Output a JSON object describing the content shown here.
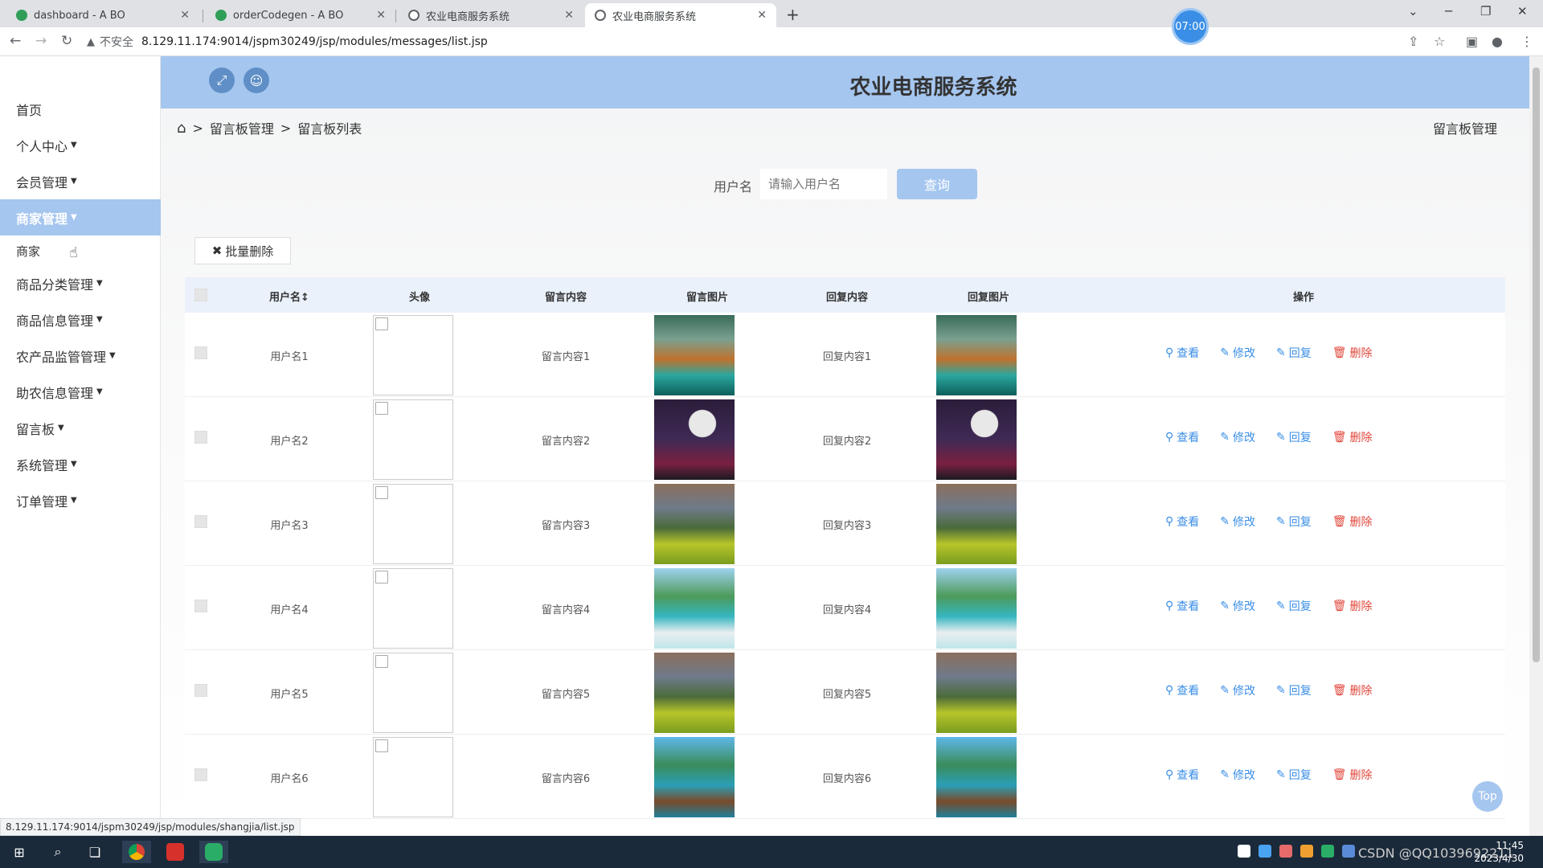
{
  "browser": {
    "tabs": [
      {
        "title": "dashboard - A BO",
        "active": false
      },
      {
        "title": "orderCodegen - A BO",
        "active": false
      },
      {
        "title": "农业电商服务系统",
        "active": false
      },
      {
        "title": "农业电商服务系统",
        "active": true
      }
    ],
    "new_tab": "+",
    "clock": "07:00",
    "insecure_label": "不安全",
    "url": "8.129.11.174:9014/jspm30249/jsp/modules/messages/list.jsp",
    "status_url": "8.129.11.174:9014/jspm30249/jsp/modules/shangjia/list.jsp"
  },
  "sidebar": {
    "items": [
      {
        "label": "首页",
        "caret": false
      },
      {
        "label": "个人中心",
        "caret": true
      },
      {
        "label": "会员管理",
        "caret": true
      },
      {
        "label": "商家管理",
        "caret": true,
        "active": true
      },
      {
        "label": "商品分类管理",
        "caret": true
      },
      {
        "label": "商品信息管理",
        "caret": true
      },
      {
        "label": "农产品监管管理",
        "caret": true
      },
      {
        "label": "助农信息管理",
        "caret": true
      },
      {
        "label": "留言板",
        "caret": true
      },
      {
        "label": "系统管理",
        "caret": true
      },
      {
        "label": "订单管理",
        "caret": true
      }
    ],
    "sub_item": "商家"
  },
  "header": {
    "title": "农业电商服务系统",
    "fullscreen_icon": "expand-icon",
    "user_icon": "user-icon"
  },
  "breadcrumb": {
    "sep": ">",
    "level1": "留言板管理",
    "level2": "留言板列表",
    "right": "留言板管理"
  },
  "search": {
    "label": "用户名",
    "placeholder": "请输入用户名",
    "button": "查询"
  },
  "bulk_delete": "批量删除",
  "table": {
    "columns": [
      "用户名",
      "头像",
      "留言内容",
      "留言图片",
      "回复内容",
      "回复图片",
      "操作"
    ],
    "sort_indicator": "↕",
    "actions": {
      "view": "查看",
      "edit": "修改",
      "reply": "回复",
      "delete": "删除"
    },
    "rows": [
      {
        "username": "用户名1",
        "content": "留言内容1",
        "reply": "回复内容1",
        "img": "waterfall"
      },
      {
        "username": "用户名2",
        "content": "留言内容2",
        "reply": "回复内容2",
        "img": "moon"
      },
      {
        "username": "用户名3",
        "content": "留言内容3",
        "reply": "回复内容3",
        "img": "meadow"
      },
      {
        "username": "用户名4",
        "content": "留言内容4",
        "reply": "回复内容4",
        "img": "beach"
      },
      {
        "username": "用户名5",
        "content": "留言内容5",
        "reply": "回复内容5",
        "img": "meadow"
      },
      {
        "username": "用户名6",
        "content": "留言内容6",
        "reply": "回复内容6",
        "img": "pier"
      }
    ]
  },
  "top_button": "Top",
  "taskbar": {
    "time": "11:45",
    "date": "2023/4/30",
    "watermark": "CSDN @QQ1039692211"
  },
  "colors": {
    "accent": "#a5c6ef",
    "link": "#3a8ee6",
    "danger": "#e0463a"
  }
}
